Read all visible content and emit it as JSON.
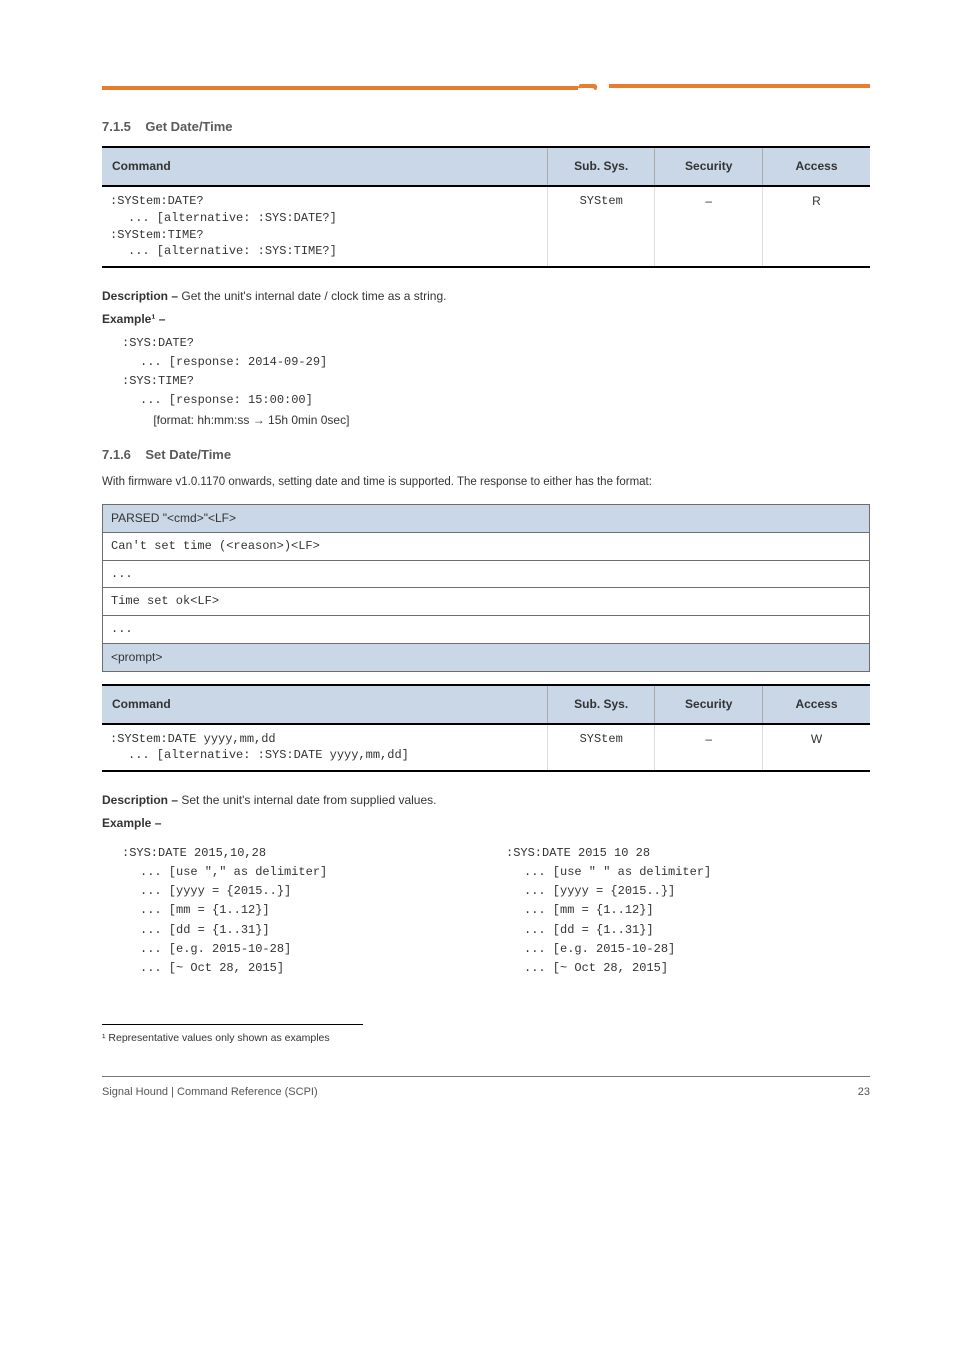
{
  "section1": {
    "title": "7.1.5    Get Date/Time",
    "table1": {
      "headers": [
        "Command",
        "Sub. Sys.",
        "Security",
        "Access"
      ],
      "rows": [
        {
          "c0a": ":SYStem:DATE?",
          "c0b": "... [alternative: :SYS:DATE?]",
          "c0c": ":SYStem:TIME?",
          "c0d": "... [alternative: :SYS:TIME?]",
          "c1": "SYStem",
          "c2": "–",
          "c3": "R"
        }
      ]
    },
    "desc_label": "Description –",
    "desc": "Get the unit's internal date / clock time as a string.",
    "ex_label": "Example¹ –",
    "code": {
      "l1": ":SYS:DATE?",
      "l2": "... [response: 2014-09-29]",
      "l3": ":SYS:TIME?",
      "l4": "... [response: 15:00:00]",
      "l5": "    [format: hh:mm:ss → 15h 0min 0sec]"
    }
  },
  "section2": {
    "title": "7.1.6    Set Date/Time",
    "pre": "With firmware v1.0.1170 onwards, setting date and time is supported. The response to either has the format:",
    "resp": {
      "hdr": "PARSED \"<cmd>\"<LF>",
      "r1": "Can't set time (<reason>)<LF>",
      "r2": "...",
      "r3": "Time set ok<LF>",
      "r4": "...",
      "ftr": "<prompt>"
    },
    "table2": {
      "headers": [
        "Command",
        "Sub. Sys.",
        "Security",
        "Access"
      ],
      "rows": [
        {
          "c0a": ":SYStem:DATE yyyy,mm,dd",
          "c0b": "... [alternative: :SYS:DATE yyyy,mm,dd]",
          "c1": "SYStem",
          "c2": "–",
          "c3": "W"
        }
      ]
    },
    "desc_label": "Description –",
    "desc": "Set the unit's internal date from supplied values.",
    "ex_label": "Example –",
    "code_left": {
      "l1": ":SYS:DATE 2015,10,28",
      "l2": "... [use \",\" as delimiter]",
      "l3": "... [yyyy = {2015..}]",
      "l4": "... [mm = {1..12}]",
      "l5": "... [dd = {1..31}]",
      "l6": "... [e.g. 2015-10-28]",
      "l7": "... [~ Oct 28, 2015]"
    },
    "code_right": {
      "l1": ":SYS:DATE 2015 10 28",
      "l2": "... [use \" \" as delimiter]",
      "l3": "... [yyyy = {2015..}]",
      "l4": "... [mm = {1..12}]",
      "l5": "... [dd = {1..31}]",
      "l6": "... [e.g. 2015-10-28]",
      "l7": "... [~ Oct 28, 2015]"
    }
  },
  "footnote": "¹ Representative values only shown as examples",
  "footer": {
    "left": "Signal Hound | Command Reference (SCPI)",
    "right": "23"
  }
}
